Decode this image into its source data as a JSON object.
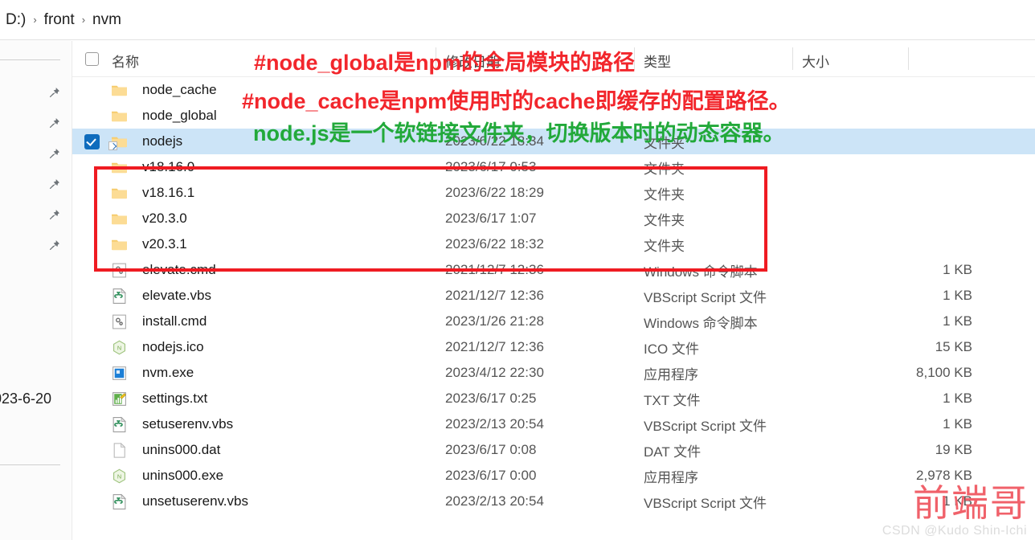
{
  "breadcrumb": {
    "items": [
      "D:)",
      "front",
      "nvm"
    ],
    "separator": "›"
  },
  "left_rail": {
    "pin_count": 6,
    "pin_icon": "pin-icon",
    "date_text": "023-6-20"
  },
  "columns": {
    "name": "名称",
    "date_modified": "修改日期",
    "type": "类型",
    "size": "大小"
  },
  "rows": [
    {
      "name": "node_cache",
      "date": "",
      "type": "",
      "size": "",
      "icon": "folder-icon",
      "selected": false,
      "checked": false
    },
    {
      "name": "node_global",
      "date": "",
      "type": "",
      "size": "",
      "icon": "folder-icon",
      "selected": false,
      "checked": false
    },
    {
      "name": "nodejs",
      "date": "2023/6/22 18:34",
      "type": "文件夹",
      "size": "",
      "icon": "folder-shortcut-icon",
      "selected": true,
      "checked": true
    },
    {
      "name": "v18.16.0",
      "date": "2023/6/17 0:53",
      "type": "文件夹",
      "size": "",
      "icon": "folder-icon",
      "selected": false,
      "checked": false
    },
    {
      "name": "v18.16.1",
      "date": "2023/6/22 18:29",
      "type": "文件夹",
      "size": "",
      "icon": "folder-icon",
      "selected": false,
      "checked": false
    },
    {
      "name": "v20.3.0",
      "date": "2023/6/17 1:07",
      "type": "文件夹",
      "size": "",
      "icon": "folder-icon",
      "selected": false,
      "checked": false
    },
    {
      "name": "v20.3.1",
      "date": "2023/6/22 18:32",
      "type": "文件夹",
      "size": "",
      "icon": "folder-icon",
      "selected": false,
      "checked": false
    },
    {
      "name": "elevate.cmd",
      "date": "2021/12/7 12:36",
      "type": "Windows 命令脚本",
      "size": "1 KB",
      "icon": "cmd-script-icon",
      "selected": false,
      "checked": false
    },
    {
      "name": "elevate.vbs",
      "date": "2021/12/7 12:36",
      "type": "VBScript Script 文件",
      "size": "1 KB",
      "icon": "vbscript-icon",
      "selected": false,
      "checked": false
    },
    {
      "name": "install.cmd",
      "date": "2023/1/26 21:28",
      "type": "Windows 命令脚本",
      "size": "1 KB",
      "icon": "cmd-script-icon",
      "selected": false,
      "checked": false
    },
    {
      "name": "nodejs.ico",
      "date": "2021/12/7 12:36",
      "type": "ICO 文件",
      "size": "15 KB",
      "icon": "nodejs-ico-icon",
      "selected": false,
      "checked": false
    },
    {
      "name": "nvm.exe",
      "date": "2023/4/12 22:30",
      "type": "应用程序",
      "size": "8,100 KB",
      "icon": "exe-app-icon",
      "selected": false,
      "checked": false
    },
    {
      "name": "settings.txt",
      "date": "2023/6/17 0:25",
      "type": "TXT 文件",
      "size": "1 KB",
      "icon": "txt-file-icon",
      "selected": false,
      "checked": false
    },
    {
      "name": "setuserenv.vbs",
      "date": "2023/2/13 20:54",
      "type": "VBScript Script 文件",
      "size": "1 KB",
      "icon": "vbscript-icon",
      "selected": false,
      "checked": false
    },
    {
      "name": "unins000.dat",
      "date": "2023/6/17 0:08",
      "type": "DAT 文件",
      "size": "19 KB",
      "icon": "blank-file-icon",
      "selected": false,
      "checked": false
    },
    {
      "name": "unins000.exe",
      "date": "2023/6/17 0:00",
      "type": "应用程序",
      "size": "2,978 KB",
      "icon": "nodejs-ico-icon",
      "selected": false,
      "checked": false
    },
    {
      "name": "unsetuserenv.vbs",
      "date": "2023/2/13 20:54",
      "type": "VBScript Script 文件",
      "size": "1 KB",
      "icon": "vbscript-icon",
      "selected": false,
      "checked": false
    }
  ],
  "annotations": {
    "line1": "#node_global是npm的全局模块的路径",
    "line2": "#node_cache是npm使用时的cache即缓存的配置路径。",
    "line3": "node.js是一个软链接文件夹，切换版本时的动态容器。",
    "color_red": "#f2262c",
    "color_green": "#22a93a",
    "box_color": "#ef1b22"
  },
  "watermark": {
    "main": "前端哥",
    "sub": "CSDN @Kudo Shin-Ichi"
  }
}
